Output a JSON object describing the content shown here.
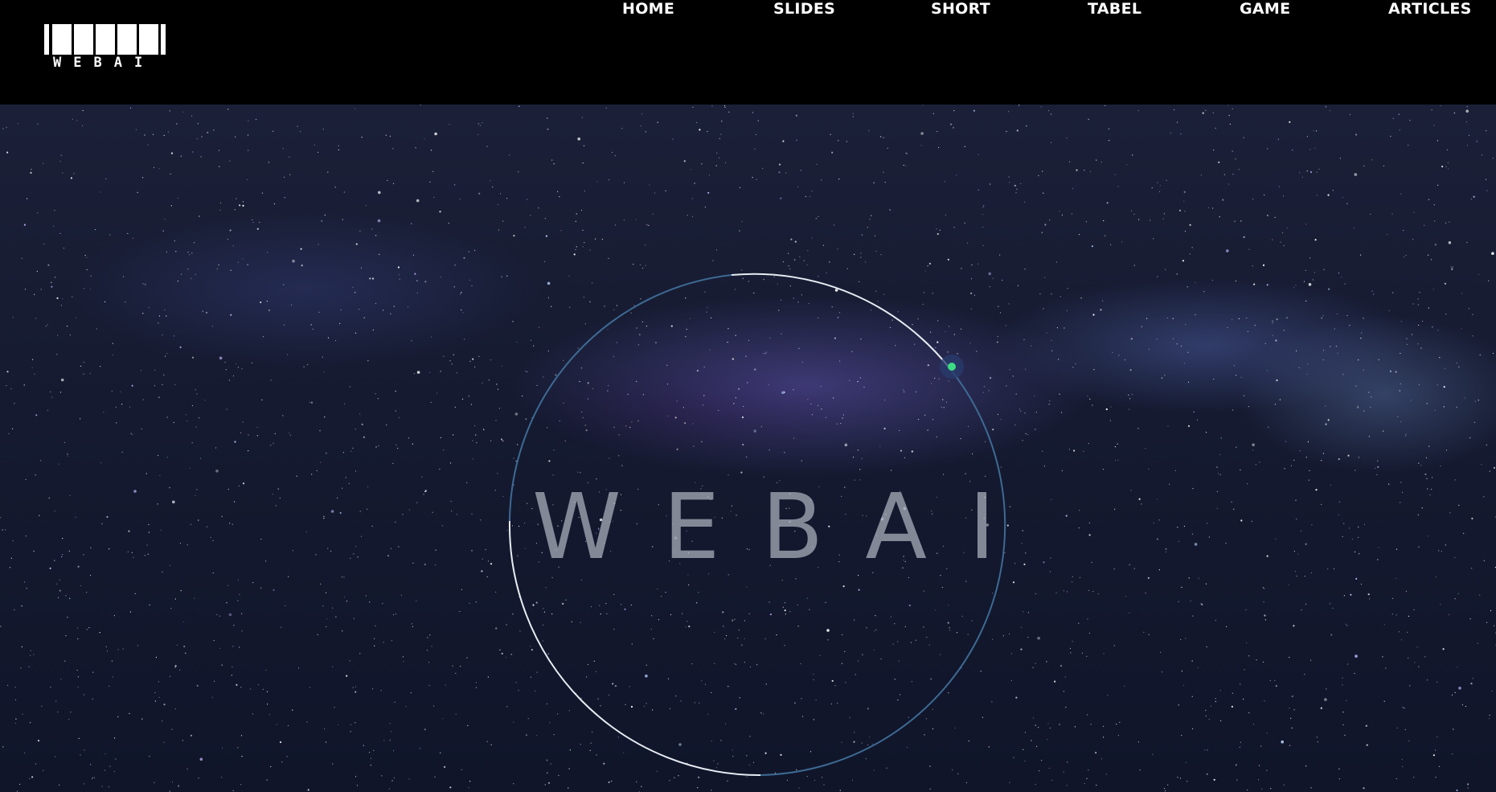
{
  "brand": {
    "logo_text": "WEBAI"
  },
  "nav": {
    "items": [
      {
        "label": "HOME"
      },
      {
        "label": "SLIDES"
      },
      {
        "label": "SHORT"
      },
      {
        "label": "TABEL"
      },
      {
        "label": "GAME"
      },
      {
        "label": "ARTICLES"
      }
    ]
  },
  "hero": {
    "title": "WEBAI",
    "background": "starry-night-sky",
    "orbit_dot_color": "#3ddc84"
  },
  "colors": {
    "topbar": "#000000",
    "nav_text": "#ffffff",
    "ring_white": "#e8ecf2",
    "ring_blue": "#3d6a93"
  }
}
